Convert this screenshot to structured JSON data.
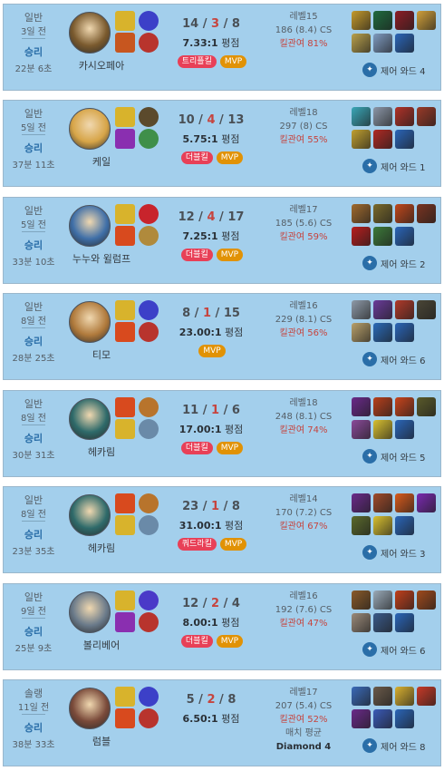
{
  "matches": [
    {
      "queue": "일반",
      "time_ago": "3일 전",
      "result": "승리",
      "duration": "22분 6초",
      "champion": "카시오페아",
      "kills": "14",
      "deaths": "3",
      "assists": "8",
      "kda_ratio": "7.33:1",
      "kda_suffix": "평점",
      "badges": [
        "트리플킬",
        "MVP"
      ],
      "level": "레벨15",
      "cs": "186 (8.4) CS",
      "kill_participation": "킬관여 81%",
      "avg_tier_label": "",
      "avg_tier": "",
      "control_wards": "제어 와드 4",
      "colors": {
        "champ": "#7a5a2e",
        "spell1": "#d8b32c",
        "spell2": "#c7561f",
        "rune1": "#3c40c8",
        "rune2": "#b8342d",
        "items": [
          "#c49a2c",
          "#1f6b3e",
          "#8c1e26",
          "#d0a03a",
          "#b8a04c",
          "#7e9ac0",
          "#2a65b8"
        ]
      }
    },
    {
      "queue": "일반",
      "time_ago": "5일 전",
      "result": "승리",
      "duration": "37분 11초",
      "champion": "케일",
      "kills": "10",
      "deaths": "4",
      "assists": "13",
      "kda_ratio": "5.75:1",
      "kda_suffix": "평점",
      "badges": [
        "더블킬",
        "MVP"
      ],
      "level": "레벨18",
      "cs": "297 (8) CS",
      "kill_participation": "킬관여 55%",
      "avg_tier_label": "",
      "avg_tier": "",
      "control_wards": "제어 와드 1",
      "colors": {
        "champ": "#d7a548",
        "spell1": "#d8b32c",
        "spell2": "#8a2fb0",
        "rune1": "#5b4a2c",
        "rune2": "#3f8f4a",
        "items": [
          "#3aa7b8",
          "#8c97a8",
          "#b03228",
          "#9a3a28",
          "#c0a030",
          "#b02a24",
          "#2a65b8"
        ]
      }
    },
    {
      "queue": "일반",
      "time_ago": "5일 전",
      "result": "승리",
      "duration": "33분 10초",
      "champion": "누누와 윌럼프",
      "kills": "12",
      "deaths": "4",
      "assists": "17",
      "kda_ratio": "7.25:1",
      "kda_suffix": "평점",
      "badges": [
        "더블킬",
        "MVP"
      ],
      "level": "레벨17",
      "cs": "185 (5.6) CS",
      "kill_participation": "킬관여 59%",
      "avg_tier_label": "",
      "avg_tier": "",
      "control_wards": "제어 와드 2",
      "colors": {
        "champ": "#3f6fa8",
        "spell1": "#d8b32c",
        "spell2": "#d84a1e",
        "rune1": "#c8242c",
        "rune2": "#b08a3c",
        "items": [
          "#a06a2e",
          "#7a6a2c",
          "#c0481c",
          "#7a3420",
          "#b81e1e",
          "#3c7a3a",
          "#2a65b8"
        ]
      }
    },
    {
      "queue": "일반",
      "time_ago": "8일 전",
      "result": "승리",
      "duration": "28분 25초",
      "champion": "티모",
      "kills": "8",
      "deaths": "1",
      "assists": "15",
      "kda_ratio": "23.00:1",
      "kda_suffix": "평점",
      "badges": [
        "MVP"
      ],
      "level": "레벨16",
      "cs": "229 (8.1) CS",
      "kill_participation": "킬관여 56%",
      "avg_tier_label": "",
      "avg_tier": "",
      "control_wards": "제어 와드 6",
      "colors": {
        "champ": "#b07a3c",
        "spell1": "#d8b32c",
        "spell2": "#d84a1e",
        "rune1": "#3c40c8",
        "rune2": "#b8342d",
        "items": [
          "#8e9aa8",
          "#6a3c9a",
          "#b03a2a",
          "#4a4636",
          "#b8a06a",
          "#2a6ab8",
          "#2a65b8"
        ]
      }
    },
    {
      "queue": "일반",
      "time_ago": "8일 전",
      "result": "승리",
      "duration": "30분 31초",
      "champion": "헤카림",
      "kills": "11",
      "deaths": "1",
      "assists": "6",
      "kda_ratio": "17.00:1",
      "kda_suffix": "평점",
      "badges": [
        "더블킬",
        "MVP"
      ],
      "level": "레벨18",
      "cs": "248 (8.1) CS",
      "kill_participation": "킬관여 74%",
      "avg_tier_label": "",
      "avg_tier": "",
      "control_wards": "제어 와드 5",
      "colors": {
        "champ": "#2e6a6a",
        "spell1": "#d84a1e",
        "spell2": "#d8b32c",
        "rune1": "#b8742c",
        "rune2": "#6a8aa8",
        "items": [
          "#6a2a8a",
          "#b8401c",
          "#c8441c",
          "#5a5a2a",
          "#8a4a9a",
          "#d8c030",
          "#2a65b8"
        ]
      }
    },
    {
      "queue": "일반",
      "time_ago": "8일 전",
      "result": "승리",
      "duration": "23분 35초",
      "champion": "헤카림",
      "kills": "23",
      "deaths": "1",
      "assists": "8",
      "kda_ratio": "31.00:1",
      "kda_suffix": "평점",
      "badges": [
        "쿼드라킬",
        "MVP"
      ],
      "level": "레벨14",
      "cs": "170 (7.2) CS",
      "kill_participation": "킬관여 67%",
      "avg_tier_label": "",
      "avg_tier": "",
      "control_wards": "제어 와드 3",
      "colors": {
        "champ": "#2e6a6a",
        "spell1": "#d84a1e",
        "spell2": "#d8b32c",
        "rune1": "#b8742c",
        "rune2": "#6a8aa8",
        "items": [
          "#6a2a8a",
          "#a04a2a",
          "#d85a1c",
          "#7a2ab0",
          "#5a6a2c",
          "#d8c030",
          "#2a65b8"
        ]
      }
    },
    {
      "queue": "일반",
      "time_ago": "9일 전",
      "result": "승리",
      "duration": "25분 9초",
      "champion": "볼리베어",
      "kills": "12",
      "deaths": "2",
      "assists": "4",
      "kda_ratio": "8.00:1",
      "kda_suffix": "평점",
      "badges": [
        "더블킬",
        "MVP"
      ],
      "level": "레벨16",
      "cs": "192 (7.6) CS",
      "kill_participation": "킬관여 47%",
      "avg_tier_label": "",
      "avg_tier": "",
      "control_wards": "제어 와드 6",
      "colors": {
        "champ": "#6a7a8a",
        "spell1": "#d8b32c",
        "spell2": "#8a2fb0",
        "rune1": "#4a3ac8",
        "rune2": "#b8342d",
        "items": [
          "#8a5a2a",
          "#9aaab8",
          "#c0401c",
          "#a04a1c",
          "#9a8a7a",
          "#3a5a8a",
          "#2a65b8"
        ]
      }
    },
    {
      "queue": "솔랭",
      "time_ago": "11일 전",
      "result": "승리",
      "duration": "38분 33초",
      "champion": "럼블",
      "kills": "5",
      "deaths": "2",
      "assists": "8",
      "kda_ratio": "6.50:1",
      "kda_suffix": "평점",
      "badges": [],
      "level": "레벨17",
      "cs": "207 (5.4) CS",
      "kill_participation": "킬관여 52%",
      "avg_tier_label": "매치 평균",
      "avg_tier": "Diamond 4",
      "control_wards": "제어 와드 8",
      "colors": {
        "champ": "#7a4a3a",
        "spell1": "#d8b32c",
        "spell2": "#d84a1e",
        "rune1": "#3c40c8",
        "rune2": "#b8342d",
        "items": [
          "#3a6ab8",
          "#6a5a4a",
          "#d8b030",
          "#c83a28",
          "#6a2a8a",
          "#3a5ab8",
          "#2a65b8"
        ]
      }
    }
  ]
}
